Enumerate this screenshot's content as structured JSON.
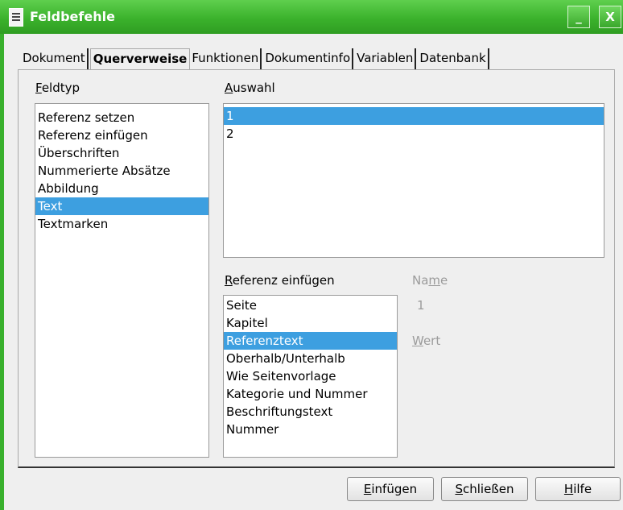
{
  "window": {
    "title": "Feldbefehle",
    "minimize_label": "_",
    "close_label": "X"
  },
  "tabs": [
    {
      "label": "Dokument",
      "active": false
    },
    {
      "label": "Querverweise",
      "active": true
    },
    {
      "label": "Funktionen",
      "active": false
    },
    {
      "label": "Dokumentinfo",
      "active": false
    },
    {
      "label": "Variablen",
      "active": false
    },
    {
      "label": "Datenbank",
      "active": false
    }
  ],
  "feldtyp": {
    "label_accel": "F",
    "label_rest": "eldtyp",
    "items": [
      "Referenz setzen",
      "Referenz einfügen",
      "Überschriften",
      "Nummerierte Absätze",
      "Abbildung",
      "Text",
      "Textmarken"
    ],
    "selected": "Text"
  },
  "auswahl": {
    "label_accel": "A",
    "label_rest": "uswahl",
    "items": [
      "1",
      "2"
    ],
    "selected": "1"
  },
  "referenz": {
    "label_accel": "R",
    "label_rest": "eferenz einfügen",
    "items": [
      "Seite",
      "Kapitel",
      "Referenztext",
      "Oberhalb/Unterhalb",
      "Wie Seitenvorlage",
      "Kategorie und Nummer",
      "Beschriftungstext",
      "Nummer"
    ],
    "selected": "Referenztext"
  },
  "name_field": {
    "label_pre": "Na",
    "label_accel": "m",
    "label_post": "e",
    "value": "1"
  },
  "wert_field": {
    "label_accel": "W",
    "label_rest": "ert"
  },
  "buttons": {
    "insert": {
      "accel": "E",
      "rest": "infügen"
    },
    "close": {
      "accel": "S",
      "rest": "chließen"
    },
    "help": {
      "accel": "H",
      "rest": "ilfe"
    }
  },
  "colors": {
    "titlebar": "#3bb22c",
    "selection": "#3d9fe0"
  }
}
